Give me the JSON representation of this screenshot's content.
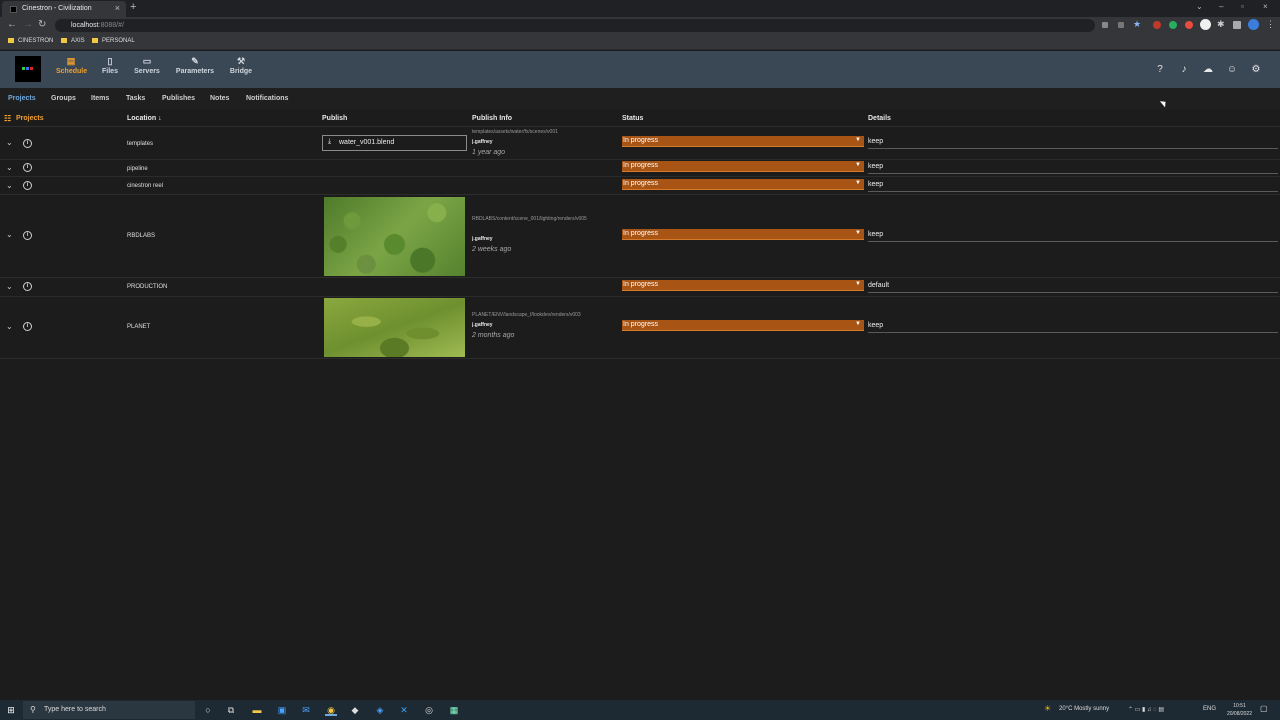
{
  "browser": {
    "tab_title": "Cinestron - Civilization",
    "url_host": "localhost",
    "url_rest": ":8088/#/",
    "bookmarks": [
      "CINESTRON",
      "AXIS",
      "PERSONAL"
    ]
  },
  "app": {
    "nav": [
      {
        "label": "Schedule",
        "icon": "calendar-icon"
      },
      {
        "label": "Files",
        "icon": "file-icon"
      },
      {
        "label": "Servers",
        "icon": "monitor-icon"
      },
      {
        "label": "Parameters",
        "icon": "pen-icon"
      },
      {
        "label": "Bridge",
        "icon": "wrench-icon"
      }
    ],
    "subtabs": [
      "Projects",
      "Groups",
      "Items",
      "Tasks",
      "Publishes",
      "Notes",
      "Notifications"
    ]
  },
  "table": {
    "headers": {
      "projects": "Projects",
      "location": "Location",
      "publish": "Publish",
      "publish_info": "Publish Info",
      "status": "Status",
      "details": "Details"
    },
    "rows": [
      {
        "location": "templates",
        "publish_file": "water_v001.blend",
        "path": "templates/assets/water/fx/scenes/v001",
        "user": "j.gaffney",
        "time": "1 year ago",
        "status": "In progress",
        "details": "keep"
      },
      {
        "location": "pipeline",
        "status": "In progress",
        "details": "keep"
      },
      {
        "location": "cinestron reel",
        "status": "In progress",
        "details": "keep"
      },
      {
        "location": "RBDLABS",
        "path": "RBDLABS/content/scene_001/lighting/renders/v005",
        "user": "j.gaffney",
        "time": "2 weeks ago",
        "status": "In progress",
        "details": "keep"
      },
      {
        "location": "PRODUCTION",
        "status": "In progress",
        "details": "default"
      },
      {
        "location": "PLANET",
        "path": "PLANET/ENV/landscape_f/lookdev/renders/v003",
        "user": "j.gaffney",
        "time": "2 months ago",
        "status": "In progress",
        "details": "keep"
      }
    ]
  },
  "taskbar": {
    "search_placeholder": "Type here to search",
    "weather": "20°C  Mostly sunny",
    "lang": "ENG",
    "time": "10:51",
    "date": "20/08/2022"
  }
}
